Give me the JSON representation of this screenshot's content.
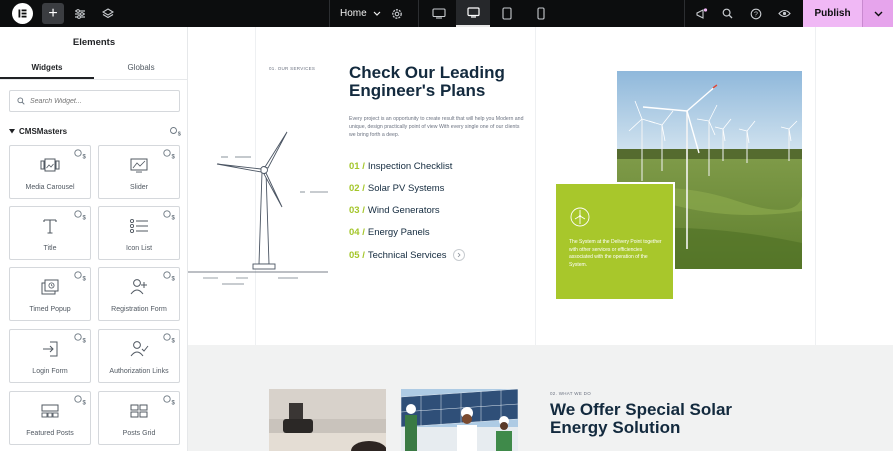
{
  "topbar": {
    "page_selector": "Home",
    "publish_label": "Publish",
    "accent_color": "#f0b8f5"
  },
  "sidebar": {
    "title": "Elements",
    "tabs": [
      {
        "label": "Widgets",
        "active": true
      },
      {
        "label": "Globals",
        "active": false
      }
    ],
    "search_placeholder": "Search Widget...",
    "section_label": "CMSMasters",
    "widgets": [
      {
        "label": "Media Carousel",
        "icon": "media-carousel-icon"
      },
      {
        "label": "Slider",
        "icon": "slider-icon"
      },
      {
        "label": "Title",
        "icon": "title-icon"
      },
      {
        "label": "Icon List",
        "icon": "icon-list-icon"
      },
      {
        "label": "Timed Popup",
        "icon": "timed-popup-icon"
      },
      {
        "label": "Registration Form",
        "icon": "registration-form-icon"
      },
      {
        "label": "Login Form",
        "icon": "login-form-icon"
      },
      {
        "label": "Authorization Links",
        "icon": "authorization-links-icon"
      },
      {
        "label": "Featured Posts",
        "icon": "featured-posts-icon"
      },
      {
        "label": "Posts Grid",
        "icon": "posts-grid-icon"
      }
    ]
  },
  "canvas": {
    "services_tag": "01. OUR SERVICES",
    "services_heading": "Check Our Leading Engineer's Plans",
    "services_body": "Every project is an opportunity to create result that will help you Modern and unique, design practically point of view With every single one of our clients we bring forth a deep.",
    "services": [
      {
        "num": "01 /",
        "label": "Inspection Checklist"
      },
      {
        "num": "02 /",
        "label": "Solar PV Systems"
      },
      {
        "num": "03 /",
        "label": "Wind Generators"
      },
      {
        "num": "04 /",
        "label": "Energy Panels"
      },
      {
        "num": "05 /",
        "label": "Technical Services"
      }
    ],
    "card_text": "The System at the Delivery Point together with other services or efficiencies associated with the operation of the System.",
    "what_tag": "02. WHAT WE DO",
    "what_heading": "We Offer Special Solar Energy Solution",
    "brand_green": "#a8c72b",
    "heading_color": "#132a3e"
  }
}
